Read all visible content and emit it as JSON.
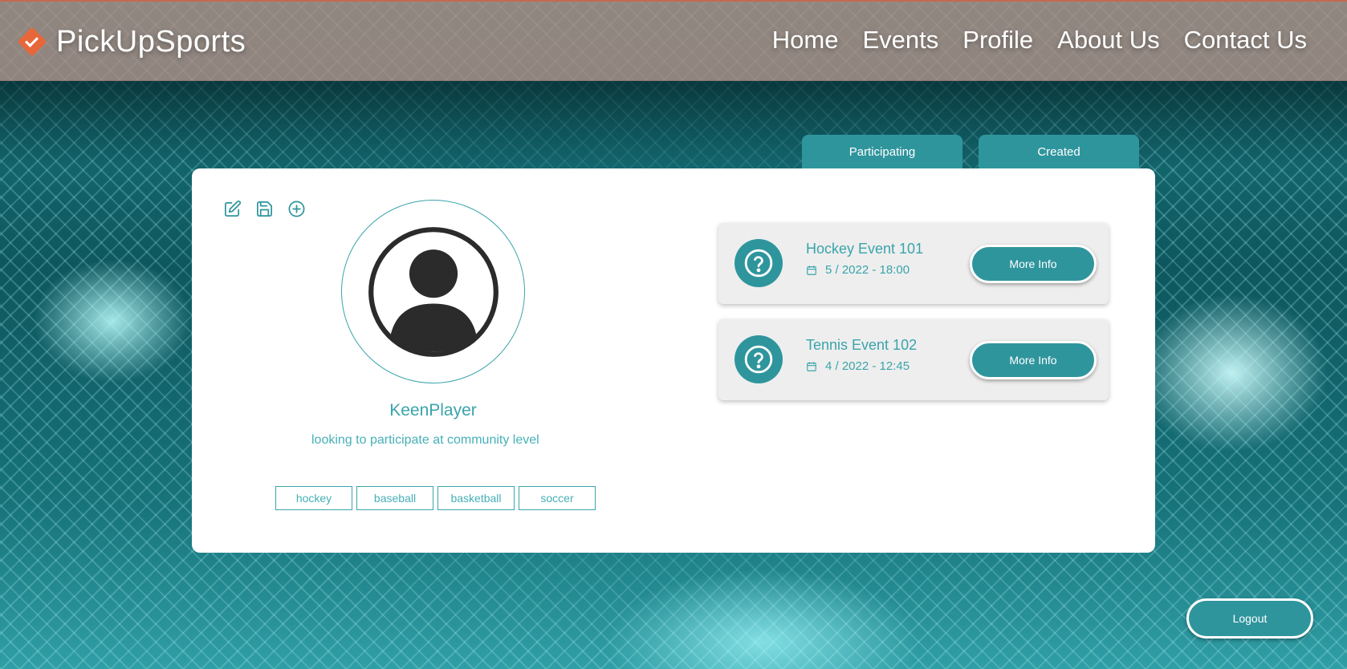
{
  "brand": {
    "name": "PickUpSports",
    "logo_icon": "check-diamond-icon",
    "logo_color": "#e8673a"
  },
  "nav": [
    "Home",
    "Events",
    "Profile",
    "About Us",
    "Contact Us"
  ],
  "tabs": {
    "participating": "Participating",
    "created": "Created"
  },
  "toolbar": {
    "icons": [
      "edit-icon",
      "save-icon",
      "add-circle-icon"
    ]
  },
  "profile": {
    "username": "KeenPlayer",
    "bio": "looking to participate at community level",
    "tags": [
      "hockey",
      "baseball",
      "basketball",
      "soccer"
    ],
    "avatar_icon": "user-avatar-icon"
  },
  "events": [
    {
      "title": "Hockey Event 101",
      "date": "5 / 2022 - 18:00",
      "button": "More Info",
      "icon": "question-icon"
    },
    {
      "title": "Tennis Event 102",
      "date": "4 / 2022 - 12:45",
      "button": "More Info",
      "icon": "question-icon"
    }
  ],
  "logout_label": "Logout",
  "colors": {
    "accent": "#2f959d",
    "text_accent": "#3aa4ab",
    "header_bg": "#b28a80"
  }
}
